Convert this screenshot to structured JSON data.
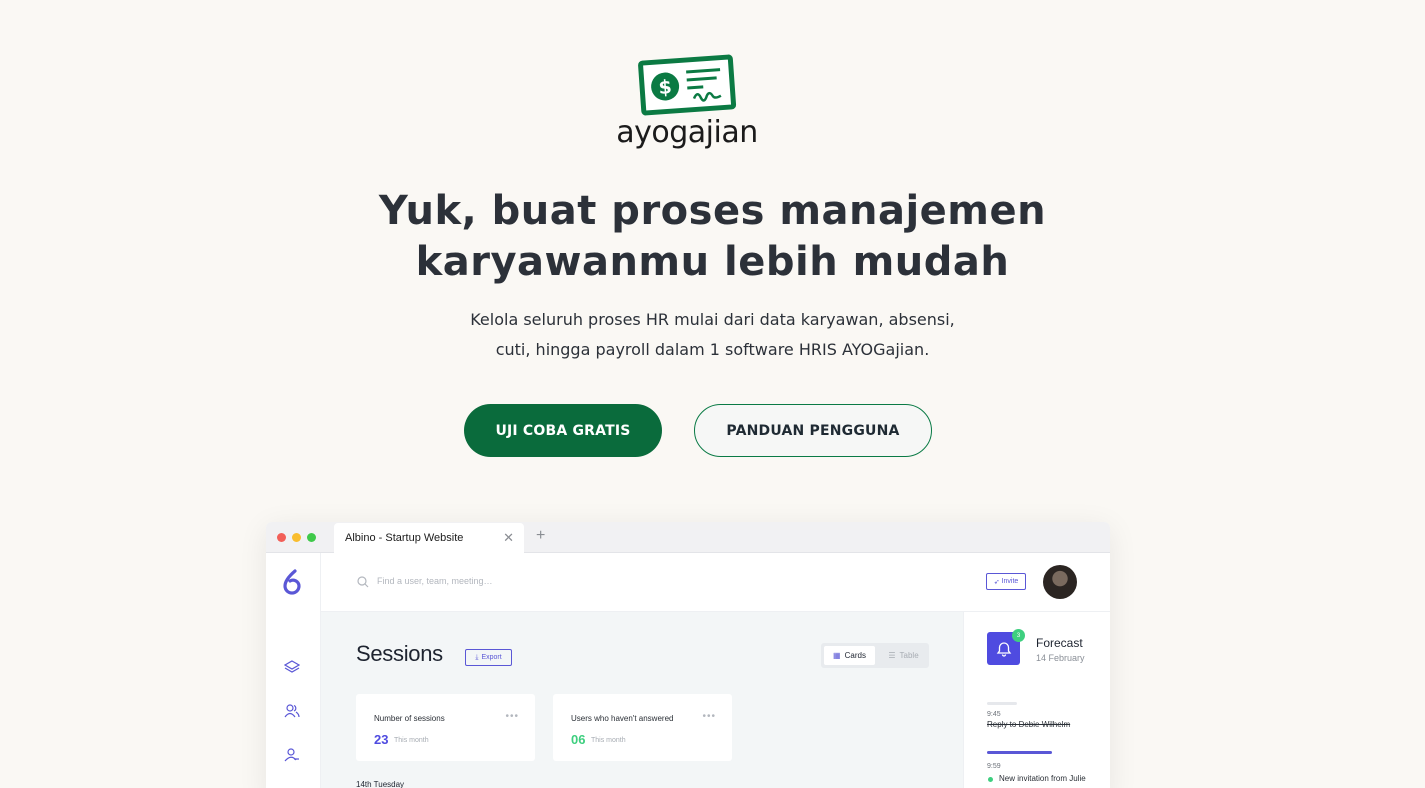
{
  "brand": {
    "name": "ayogajian",
    "logo_color": "#0b7a43"
  },
  "hero": {
    "title_line1": "Yuk, buat proses manajemen",
    "title_line2": "karyawanmu lebih mudah",
    "sub_line1": "Kelola seluruh proses HR mulai dari data karyawan, absensi,",
    "sub_line2": "cuti, hingga payroll dalam 1 software HRIS AYOGajian."
  },
  "cta": {
    "primary": "UJI COBA GRATIS",
    "secondary": "PANDUAN PENGGUNA"
  },
  "mockup": {
    "tab_title": "Albino - Startup Website",
    "search_placeholder": "Find a user, team, meeting…",
    "invite_label": "Invite",
    "page_title": "Sessions",
    "export_label": "Export",
    "view_cards": "Cards",
    "view_table": "Table",
    "cards": [
      {
        "title": "Number of sessions",
        "value": "23",
        "period": "This month",
        "color": "#4f4be0"
      },
      {
        "title": "Users  who haven't answered",
        "value": "06",
        "period": "This month",
        "color": "#3ecf7f"
      }
    ],
    "date_label": "14th Tuesday",
    "forecast": {
      "title": "Forecast",
      "date": "14 February",
      "badge": "3",
      "items": [
        {
          "time": "9:45",
          "text": "Reply to Debie Wilhelm"
        },
        {
          "time": "9:59",
          "text": "New invitation from Julie"
        }
      ]
    },
    "sidebar_icons": [
      "layers-icon",
      "users-icon",
      "user-settings-icon"
    ]
  }
}
